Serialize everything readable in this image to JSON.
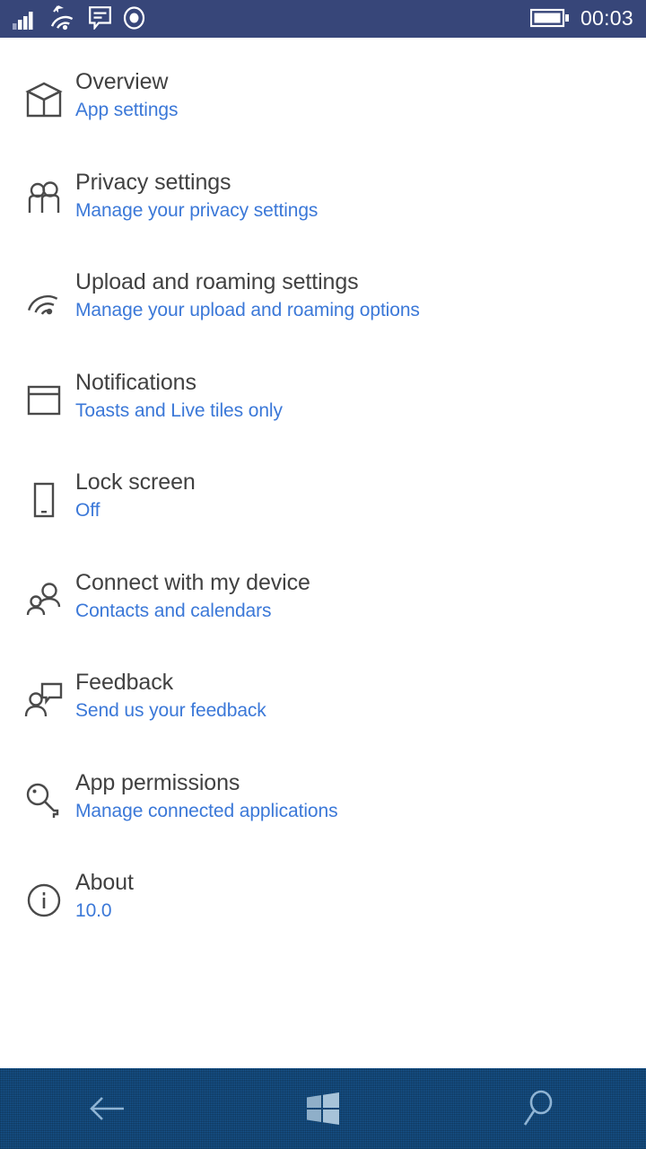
{
  "status_bar": {
    "background_color": "#374679",
    "icons": [
      {
        "name": "cellular-signal-icon",
        "label": "Cellular signal"
      },
      {
        "name": "wifi-roaming-icon",
        "label": "Wi-Fi roaming"
      },
      {
        "name": "sms-message-icon",
        "label": "SMS message"
      },
      {
        "name": "recording-indicator-icon",
        "label": "Recording"
      }
    ],
    "battery": {
      "name": "battery-icon",
      "label": "Battery full"
    },
    "clock": "00:03"
  },
  "list": {
    "title_color": "#414141",
    "accent_color": "#3b78d8",
    "items": [
      {
        "icon": "cube-icon",
        "title": "Overview",
        "subtitle": "App settings"
      },
      {
        "icon": "two-people-icon",
        "title": "Privacy settings",
        "subtitle": "Manage your privacy settings"
      },
      {
        "icon": "wifi-icon",
        "title": "Upload and roaming settings",
        "subtitle": "Manage your upload and roaming options"
      },
      {
        "icon": "notification-icon",
        "title": "Notifications",
        "subtitle": "Toasts and Live tiles only"
      },
      {
        "icon": "phone-icon",
        "title": "Lock screen",
        "subtitle": "Off"
      },
      {
        "icon": "contacts-icon",
        "title": "Connect with my device",
        "subtitle": "Contacts and calendars"
      },
      {
        "icon": "feedback-icon",
        "title": "Feedback",
        "subtitle": "Send us your feedback"
      },
      {
        "icon": "key-icon",
        "title": "App permissions",
        "subtitle": "Manage connected applications"
      },
      {
        "icon": "info-icon",
        "title": "About",
        "subtitle": "10.0"
      }
    ]
  },
  "nav_bar": {
    "background_color": "#17558f",
    "buttons": [
      {
        "name": "back-button",
        "icon": "back-arrow-icon",
        "label": "Back"
      },
      {
        "name": "start-button",
        "icon": "windows-logo-icon",
        "label": "Start"
      },
      {
        "name": "search-button",
        "icon": "search-icon",
        "label": "Search"
      }
    ]
  }
}
